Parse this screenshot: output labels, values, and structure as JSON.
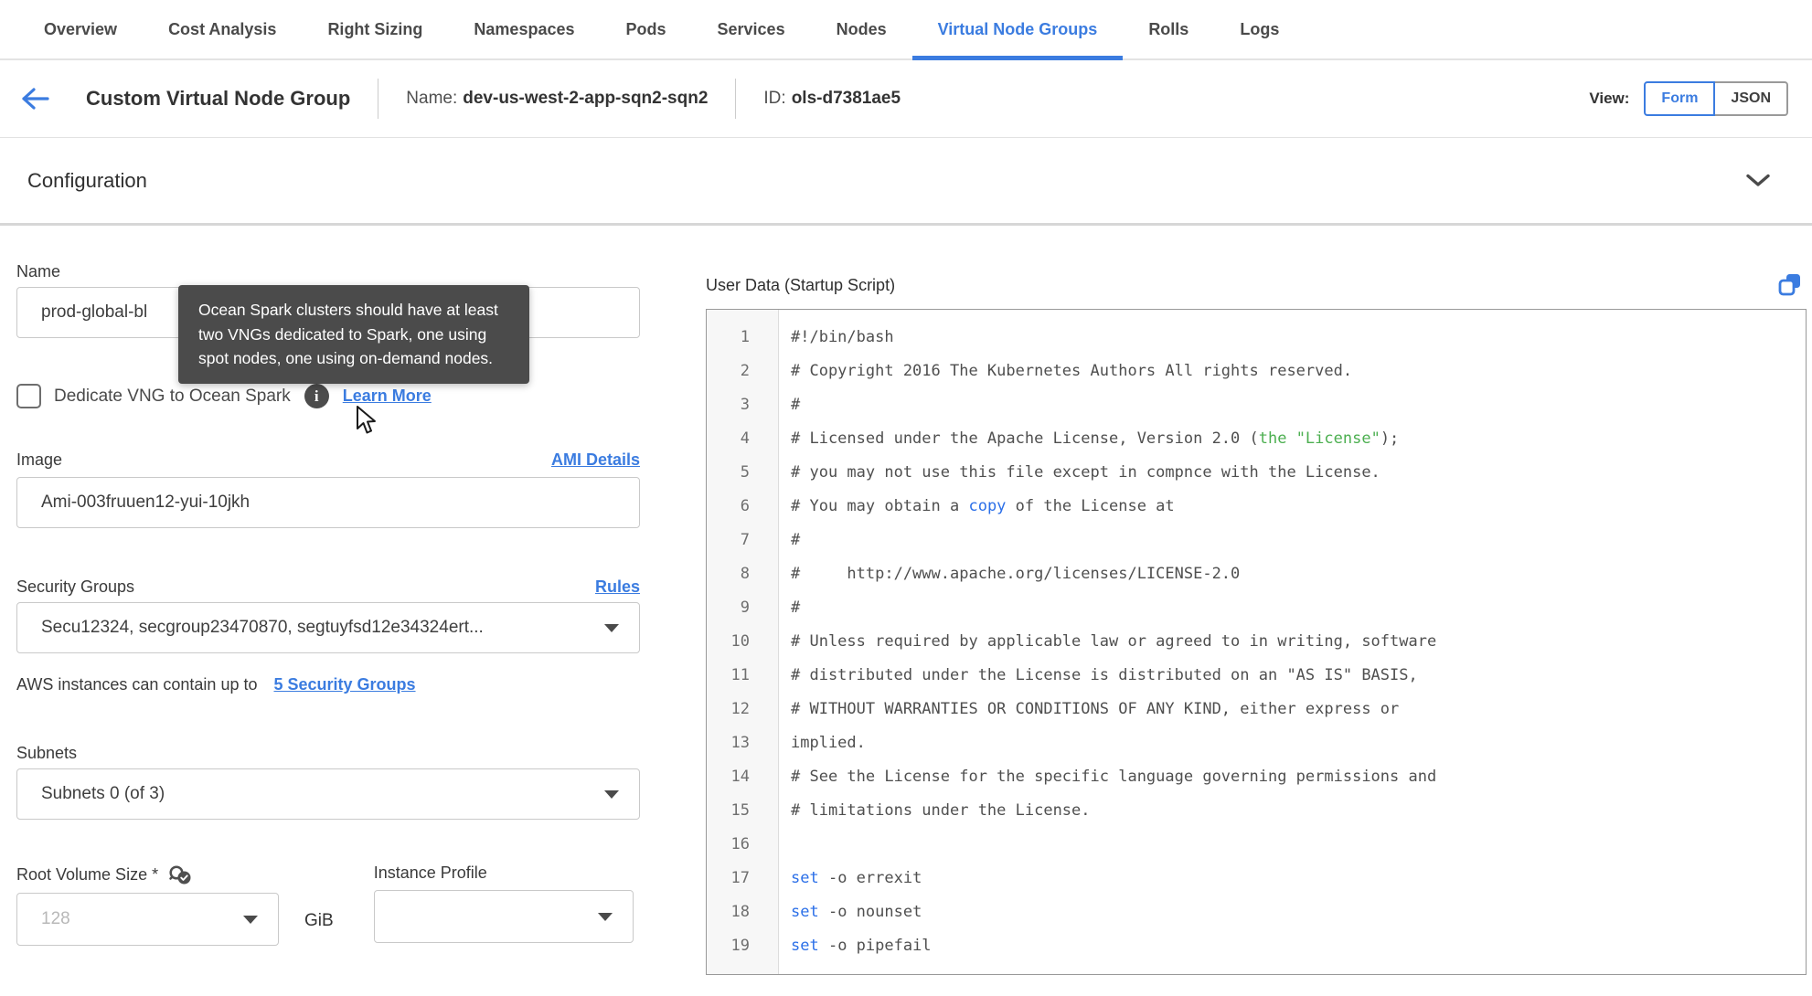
{
  "colors": {
    "accent": "#3b7ce0",
    "code_plain": "#4f4f4f",
    "code_blue": "#2b6fe8",
    "code_green": "#4caf50"
  },
  "tabs": {
    "items": [
      {
        "label": "Overview",
        "active": false
      },
      {
        "label": "Cost Analysis",
        "active": false
      },
      {
        "label": "Right Sizing",
        "active": false
      },
      {
        "label": "Namespaces",
        "active": false
      },
      {
        "label": "Pods",
        "active": false
      },
      {
        "label": "Services",
        "active": false
      },
      {
        "label": "Nodes",
        "active": false
      },
      {
        "label": "Virtual Node Groups",
        "active": true
      },
      {
        "label": "Rolls",
        "active": false
      },
      {
        "label": "Logs",
        "active": false
      }
    ]
  },
  "header": {
    "title": "Custom Virtual Node Group",
    "name_label": "Name:",
    "name_value": "dev-us-west-2-app-sqn2-sqn2",
    "id_label": "ID:",
    "id_value": "ols-d7381ae5",
    "view_label": "View:",
    "view_options": [
      {
        "label": "Form",
        "active": true
      },
      {
        "label": "JSON",
        "active": false
      }
    ]
  },
  "section": {
    "title": "Configuration"
  },
  "form": {
    "name": {
      "label": "Name",
      "value": "prod-global-bl"
    },
    "tooltip": {
      "text": "Ocean Spark clusters should have at least two VNGs dedicated to Spark, one using spot nodes, one using on-demand nodes."
    },
    "dedicate": {
      "label": "Dedicate VNG to Ocean Spark",
      "checked": false,
      "learn_more": "Learn More"
    },
    "image": {
      "label": "Image",
      "link": "AMI Details",
      "value": "Ami-003fruuen12-yui-10jkh"
    },
    "security_groups": {
      "label": "Security Groups",
      "link": "Rules",
      "value": "Secu12324, secgroup23470870, segtuyfsd12e34324ert...",
      "note_text": "AWS instances can contain up to",
      "note_link": "5 Security Groups"
    },
    "subnets": {
      "label": "Subnets",
      "value": "Subnets 0 (of 3)"
    },
    "root_volume": {
      "label": "Root Volume Size *",
      "placeholder": "128",
      "unit": "GiB"
    },
    "instance_profile": {
      "label": "Instance Profile",
      "value": ""
    }
  },
  "editor": {
    "label": "User Data (Startup Script)",
    "lines": [
      {
        "n": 1,
        "segs": [
          [
            "plain",
            "#!/bin/bash"
          ]
        ]
      },
      {
        "n": 2,
        "segs": [
          [
            "plain",
            "# Copyright 2016 The Kubernetes Authors All rights reserved."
          ]
        ]
      },
      {
        "n": 3,
        "segs": [
          [
            "plain",
            "#"
          ]
        ]
      },
      {
        "n": 4,
        "segs": [
          [
            "plain",
            "# Licensed under the Apache License, Version 2.0 ("
          ],
          [
            "green",
            "the \"License\""
          ],
          [
            "plain",
            ");"
          ]
        ]
      },
      {
        "n": 5,
        "segs": [
          [
            "plain",
            "# you may not use this file except in compnce with the License."
          ]
        ]
      },
      {
        "n": 6,
        "segs": [
          [
            "plain",
            "# You may obtain a "
          ],
          [
            "blue",
            "copy"
          ],
          [
            "plain",
            " of the License at"
          ]
        ]
      },
      {
        "n": 7,
        "segs": [
          [
            "plain",
            "#"
          ]
        ]
      },
      {
        "n": 8,
        "segs": [
          [
            "plain",
            "#     http://www.apache.org/licenses/LICENSE-2.0"
          ]
        ]
      },
      {
        "n": 9,
        "segs": [
          [
            "plain",
            "#"
          ]
        ]
      },
      {
        "n": 10,
        "segs": [
          [
            "plain",
            "# Unless required by applicable law or agreed to in writing, software"
          ]
        ]
      },
      {
        "n": 11,
        "segs": [
          [
            "plain",
            "# distributed under the License is distributed on an \"AS IS\" BASIS,"
          ]
        ]
      },
      {
        "n": 12,
        "segs": [
          [
            "plain",
            "# WITHOUT WARRANTIES OR CONDITIONS OF ANY KIND, either express or"
          ]
        ]
      },
      {
        "n": 13,
        "segs": [
          [
            "plain",
            "implied."
          ]
        ]
      },
      {
        "n": 14,
        "segs": [
          [
            "plain",
            "# See the License for the specific language governing permissions and"
          ]
        ]
      },
      {
        "n": 15,
        "segs": [
          [
            "plain",
            "# limitations under the License."
          ]
        ]
      },
      {
        "n": 16,
        "segs": [
          [
            "plain",
            ""
          ]
        ]
      },
      {
        "n": 17,
        "segs": [
          [
            "blue",
            "set"
          ],
          [
            "plain",
            " -o errexit"
          ]
        ]
      },
      {
        "n": 18,
        "segs": [
          [
            "blue",
            "set"
          ],
          [
            "plain",
            " -o nounset"
          ]
        ]
      },
      {
        "n": 19,
        "segs": [
          [
            "blue",
            "set"
          ],
          [
            "plain",
            " -o pipefail"
          ]
        ]
      }
    ]
  }
}
